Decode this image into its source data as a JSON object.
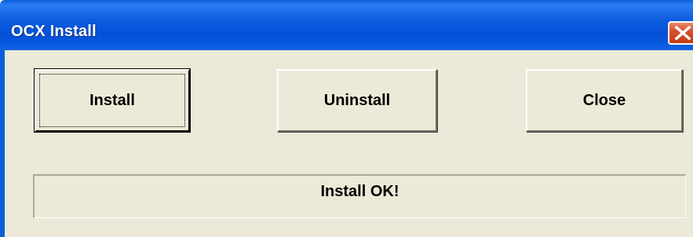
{
  "window": {
    "title": "OCX Install",
    "close_icon": "close-x-icon"
  },
  "buttons": {
    "install": "Install",
    "uninstall": "Uninstall",
    "close": "Close"
  },
  "status": {
    "message": "Install OK!"
  },
  "colors": {
    "titlebar": "#0a5fd8",
    "client": "#ece9d8",
    "close_button": "#d8502c"
  }
}
